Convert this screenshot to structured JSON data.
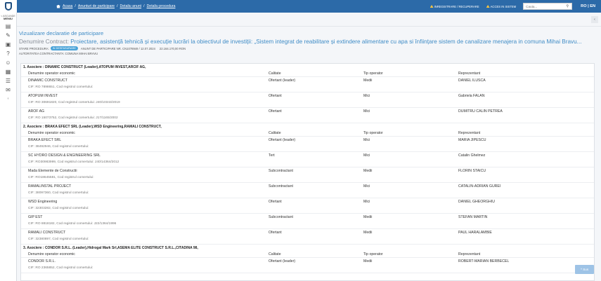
{
  "breadcrumbs": [
    "Acasa",
    "Anunturi de participare",
    "Detaliu anunt",
    "Detaliu procedura"
  ],
  "header": {
    "register_link": "INREGISTRARE / RECUPERARE",
    "login_link": "ACCES IN SISTEM",
    "search_placeholder": "Cauta...",
    "lang": "RO | EN"
  },
  "sidebar": {
    "menu_top": "< ASCUNDE",
    "menu_label": "MENIU",
    "icons": [
      "document-icon",
      "document-edit-icon",
      "briefcase-icon",
      "help-icon",
      "accessibility-icon",
      "image-icon",
      "list-icon",
      "chat-icon"
    ]
  },
  "page": {
    "title": "Vizualizare declaratie de participare",
    "contract_label": "Denumire Contract:",
    "contract_name": "Proiectare, asistență tehnică și execuție lucrări la obiectivul de investiții: „Sistem integrat de reabilitare și extindere alimentare cu apa si înființare sistem de canalizare menajera in comuna Mihai Bravu...",
    "stare_label": "STARE PROCEDURA:",
    "stare_badge": "IN DESFASURARE",
    "announcement": "ANUNT DE PARTICIPARE NR. CN1078949 / 12.07.2024",
    "value": "22.164.170,00 RON",
    "authority": "AUTORITATEA CONTRACTANTA: COMUNA MIHAI BRAVU"
  },
  "columns": [
    "Denumire operator economic",
    "Calitate",
    "Tip operator",
    "Reprezentant"
  ],
  "associations": [
    {
      "title": "1. Asociere : DINAMIC CONSTRUCT (Leader),ATOPUM INVEST,ARCIF AG,",
      "members": [
        {
          "name": "DINAMIC CONSTRUCT",
          "cif": "CIF: RO 7898651, Cod registrul comertului:",
          "calitate": "Ofertant (leader)",
          "tip": "Medii",
          "rep": "DANIEL ILUSCA"
        },
        {
          "name": "ATOPUM INVEST",
          "cif": "CIF: RO 30691820, Cod registrul comertului: J40/10343/2019",
          "calitate": "Ofertant",
          "tip": "Mici",
          "rep": "Gabriela FALAN"
        },
        {
          "name": "AROF AG",
          "cif": "CIF: RO 15073752, Cod registrul comertului: J17/1165/2002",
          "calitate": "Ofertant",
          "tip": "Mici",
          "rep": "DUMITRU CALIN PETREA"
        }
      ]
    },
    {
      "title": "2. Asociere : BRAKA EFECT SRL (Leader),WSD Engineering,RAMALI CONSTRUCT,",
      "members": [
        {
          "name": "BRAKA EFECT SRL",
          "cif": "CIF: 38492946, Cod registrul comertului:",
          "calitate": "Ofertant (leader)",
          "tip": "Mici",
          "rep": "MARIA JIPESCU"
        },
        {
          "name": "SC HYDRO DESIGN & ENGINEERING SRL",
          "cif": "CIF: RO30983999, Cod registrul comertului: J40/14364/2012",
          "calitate": "Tert",
          "tip": "Mici",
          "rep": "Catalin Ghelmez"
        },
        {
          "name": "Mada Elemente de Constructii",
          "cif": "CIF: RO18645581, Cod registrul comertului:",
          "calitate": "Subcontractant",
          "tip": "Medii",
          "rep": "FLORIN STAICU"
        },
        {
          "name": "RAMALINSTAL PROJECT",
          "cif": "CIF: 38097360, Cod registrul comertului:",
          "calitate": "Subcontractant",
          "tip": "Mici",
          "rep": "CATALIN-ADRIAN GUREI"
        },
        {
          "name": "WSD Engineering",
          "cif": "CIF: 32303282, Cod registrul comertului:",
          "calitate": "Ofertant",
          "tip": "Mici",
          "rep": "DANIEL GHEORGHIU"
        },
        {
          "name": "GIP EST",
          "cif": "CIF: RO 8818182, Cod registrul comertului: J22/1364/1996",
          "calitate": "Subcontractant",
          "tip": "Medii",
          "rep": "STEFAN MARTIN"
        },
        {
          "name": "RAMALI CONSTRUCT",
          "cif": "CIF: 32380897, Cod registrul comertului:",
          "calitate": "Ofertant",
          "tip": "Medii",
          "rep": "PAUL HARALAMBIE"
        }
      ]
    },
    {
      "title": "3. Asociere : CONDOR S.R.L. (Leader),Hidrogal Mark Srl,ASEMA ELITE CONSTRUCT S.R.L.,CITADINA 98,",
      "members": [
        {
          "name": "CONDOR S.R.L.",
          "cif": "CIF: RO 2365852, Cod registrul comertului:",
          "calitate": "Ofertant (leader)",
          "tip": "Medii",
          "rep": "ROBERT-MARIAN BERBECEL"
        }
      ]
    }
  ],
  "scroll_top_label": "^ Sus"
}
